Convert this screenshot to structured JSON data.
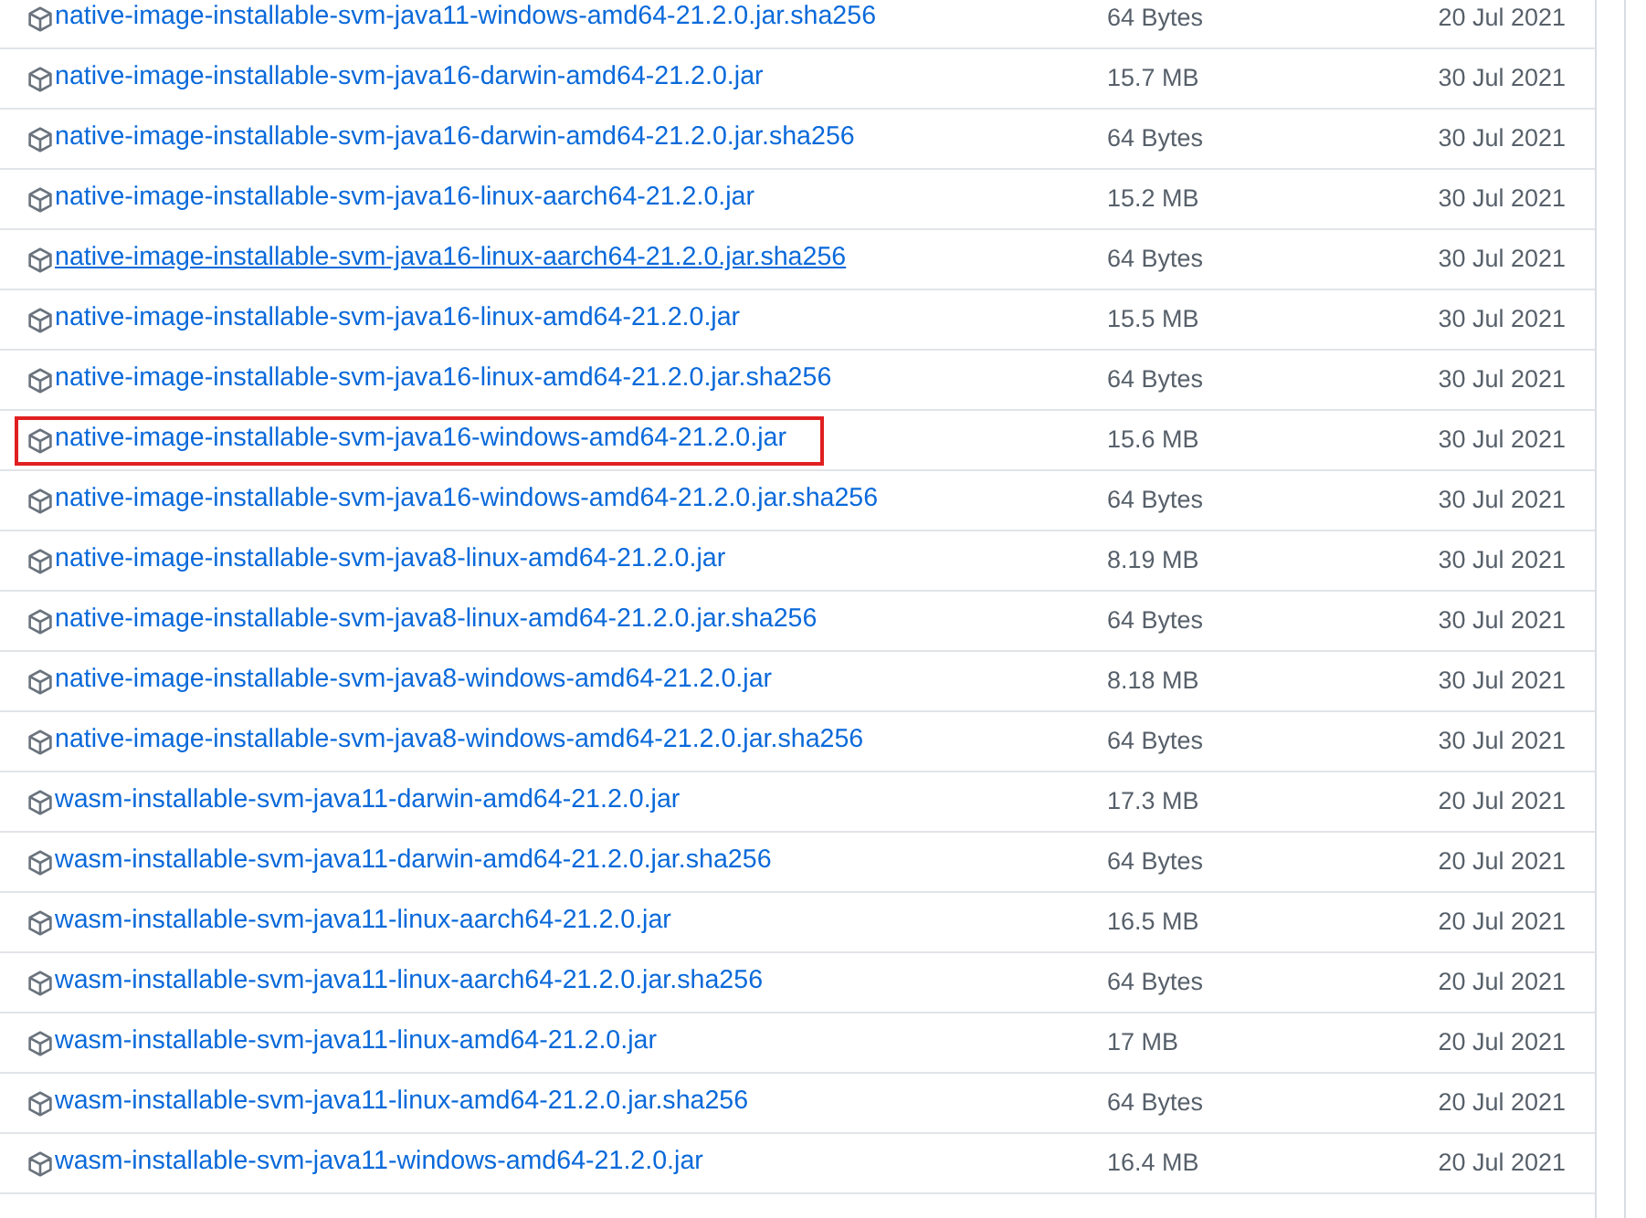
{
  "assets": [
    {
      "name": "native-image-installable-svm-java11-windows-amd64-21.2.0.jar.sha256",
      "size": "64 Bytes",
      "date": "20 Jul 2021",
      "hovered": false,
      "highlighted": false
    },
    {
      "name": "native-image-installable-svm-java16-darwin-amd64-21.2.0.jar",
      "size": "15.7 MB",
      "date": "30 Jul 2021",
      "hovered": false,
      "highlighted": false
    },
    {
      "name": "native-image-installable-svm-java16-darwin-amd64-21.2.0.jar.sha256",
      "size": "64 Bytes",
      "date": "30 Jul 2021",
      "hovered": false,
      "highlighted": false
    },
    {
      "name": "native-image-installable-svm-java16-linux-aarch64-21.2.0.jar",
      "size": "15.2 MB",
      "date": "30 Jul 2021",
      "hovered": false,
      "highlighted": false
    },
    {
      "name": "native-image-installable-svm-java16-linux-aarch64-21.2.0.jar.sha256",
      "size": "64 Bytes",
      "date": "30 Jul 2021",
      "hovered": true,
      "highlighted": false
    },
    {
      "name": "native-image-installable-svm-java16-linux-amd64-21.2.0.jar",
      "size": "15.5 MB",
      "date": "30 Jul 2021",
      "hovered": false,
      "highlighted": false
    },
    {
      "name": "native-image-installable-svm-java16-linux-amd64-21.2.0.jar.sha256",
      "size": "64 Bytes",
      "date": "30 Jul 2021",
      "hovered": false,
      "highlighted": false
    },
    {
      "name": "native-image-installable-svm-java16-windows-amd64-21.2.0.jar",
      "size": "15.6 MB",
      "date": "30 Jul 2021",
      "hovered": false,
      "highlighted": true
    },
    {
      "name": "native-image-installable-svm-java16-windows-amd64-21.2.0.jar.sha256",
      "size": "64 Bytes",
      "date": "30 Jul 2021",
      "hovered": false,
      "highlighted": false
    },
    {
      "name": "native-image-installable-svm-java8-linux-amd64-21.2.0.jar",
      "size": "8.19 MB",
      "date": "30 Jul 2021",
      "hovered": false,
      "highlighted": false
    },
    {
      "name": "native-image-installable-svm-java8-linux-amd64-21.2.0.jar.sha256",
      "size": "64 Bytes",
      "date": "30 Jul 2021",
      "hovered": false,
      "highlighted": false
    },
    {
      "name": "native-image-installable-svm-java8-windows-amd64-21.2.0.jar",
      "size": "8.18 MB",
      "date": "30 Jul 2021",
      "hovered": false,
      "highlighted": false
    },
    {
      "name": "native-image-installable-svm-java8-windows-amd64-21.2.0.jar.sha256",
      "size": "64 Bytes",
      "date": "30 Jul 2021",
      "hovered": false,
      "highlighted": false
    },
    {
      "name": "wasm-installable-svm-java11-darwin-amd64-21.2.0.jar",
      "size": "17.3 MB",
      "date": "20 Jul 2021",
      "hovered": false,
      "highlighted": false
    },
    {
      "name": "wasm-installable-svm-java11-darwin-amd64-21.2.0.jar.sha256",
      "size": "64 Bytes",
      "date": "20 Jul 2021",
      "hovered": false,
      "highlighted": false
    },
    {
      "name": "wasm-installable-svm-java11-linux-aarch64-21.2.0.jar",
      "size": "16.5 MB",
      "date": "20 Jul 2021",
      "hovered": false,
      "highlighted": false
    },
    {
      "name": "wasm-installable-svm-java11-linux-aarch64-21.2.0.jar.sha256",
      "size": "64 Bytes",
      "date": "20 Jul 2021",
      "hovered": false,
      "highlighted": false
    },
    {
      "name": "wasm-installable-svm-java11-linux-amd64-21.2.0.jar",
      "size": "17 MB",
      "date": "20 Jul 2021",
      "hovered": false,
      "highlighted": false
    },
    {
      "name": "wasm-installable-svm-java11-linux-amd64-21.2.0.jar.sha256",
      "size": "64 Bytes",
      "date": "20 Jul 2021",
      "hovered": false,
      "highlighted": false
    },
    {
      "name": "wasm-installable-svm-java11-windows-amd64-21.2.0.jar",
      "size": "16.4 MB",
      "date": "20 Jul 2021",
      "hovered": false,
      "highlighted": false
    }
  ]
}
